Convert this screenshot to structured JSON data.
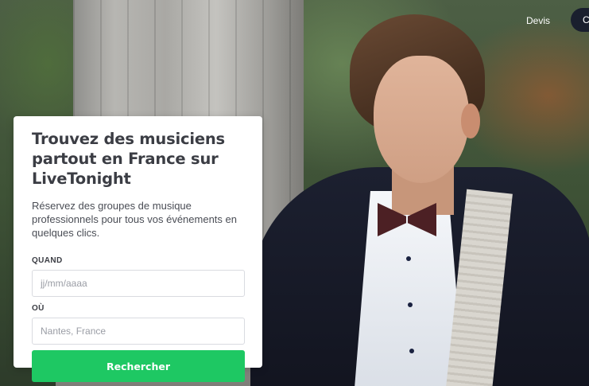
{
  "nav": {
    "devis_label": "Devis",
    "cta_label": "Connexion"
  },
  "hero": {
    "image": "musician-in-tuxedo-photo"
  },
  "search_card": {
    "title": "Trouvez des musiciens partout en France sur LiveTonight",
    "subtitle": "Réservez des groupes de musique professionnels pour tous vos événements en quelques clics.",
    "when_label": "QUAND",
    "when_placeholder": "jj/mm/aaaa",
    "where_label": "OÙ",
    "where_placeholder": "Nantes, France",
    "submit_label": "Rechercher"
  },
  "colors": {
    "accent_green": "#1ec863",
    "cta_dark": "#1a1f2e",
    "title_text": "#3b3d44"
  }
}
